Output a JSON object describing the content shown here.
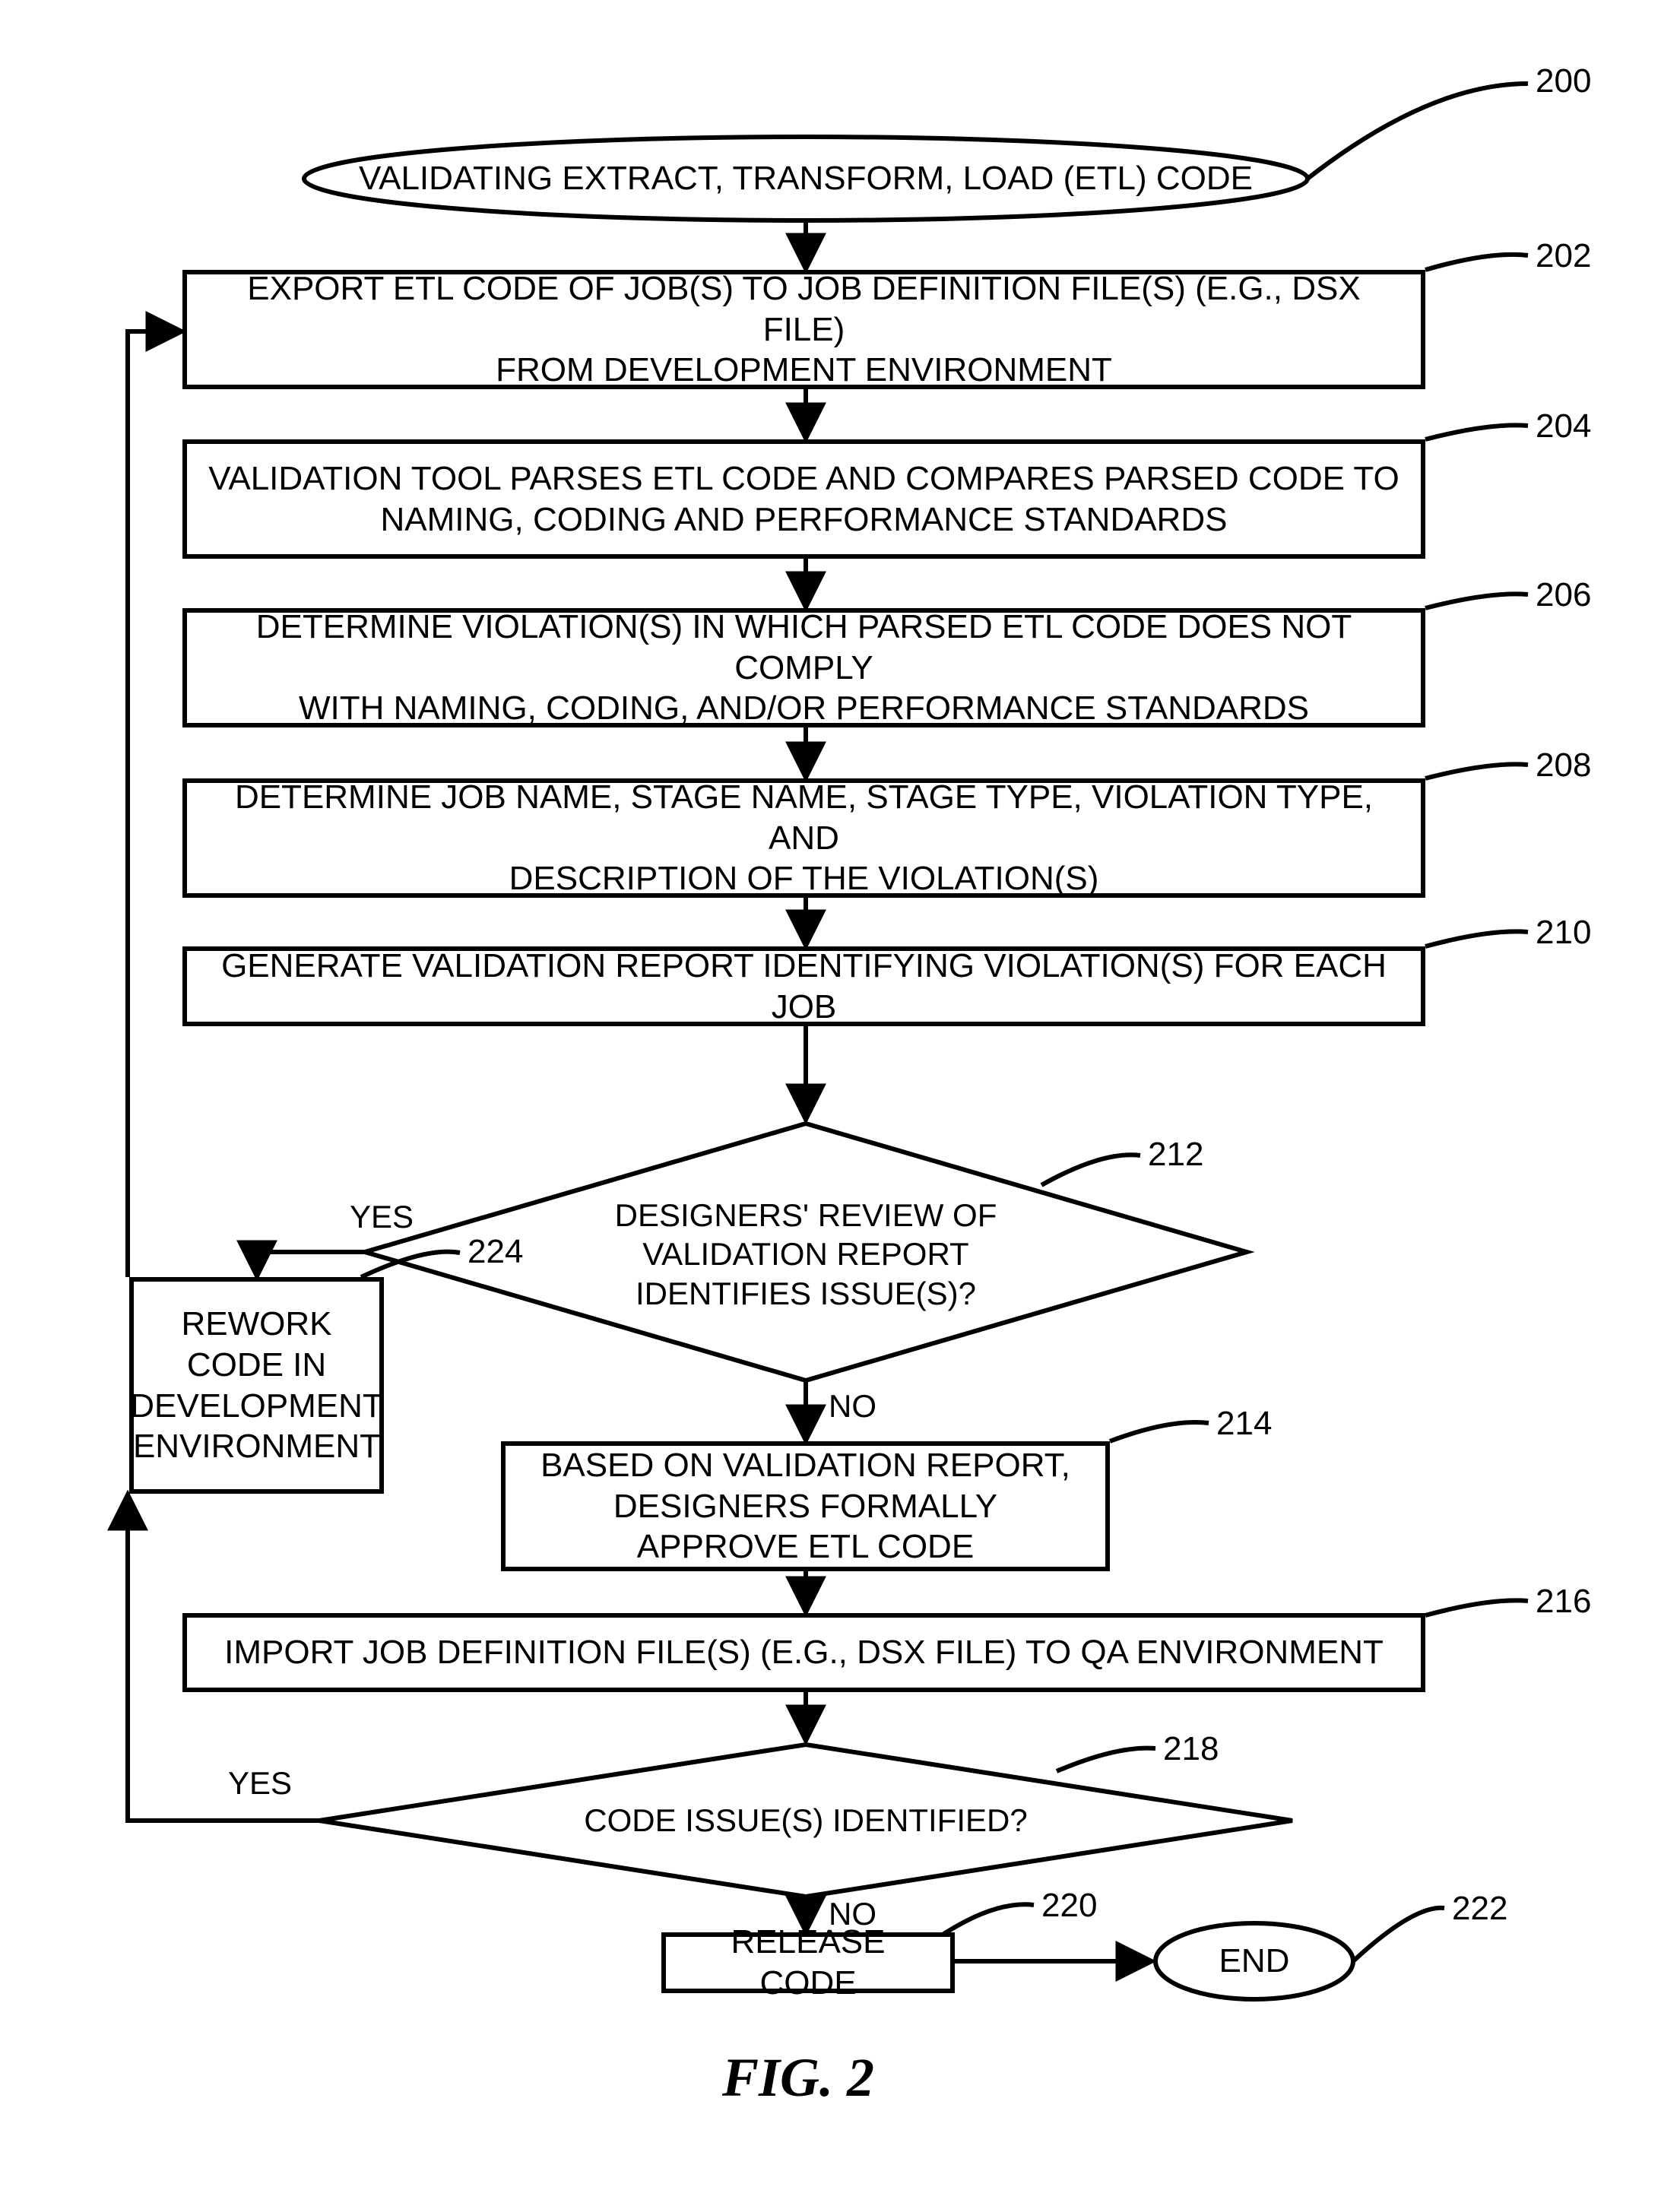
{
  "figure_caption": "FIG. 2",
  "terminal": {
    "start": {
      "text": "VALIDATING EXTRACT, TRANSFORM, LOAD (ETL) CODE",
      "callout": "200"
    },
    "end": {
      "text": "END",
      "callout": "222"
    }
  },
  "steps": {
    "s202": {
      "text": "EXPORT ETL CODE OF JOB(S) TO JOB DEFINITION FILE(S) (E.G., DSX FILE)\nFROM DEVELOPMENT ENVIRONMENT",
      "callout": "202"
    },
    "s204": {
      "text": "VALIDATION TOOL PARSES ETL CODE AND COMPARES PARSED CODE TO\nNAMING, CODING AND PERFORMANCE STANDARDS",
      "callout": "204"
    },
    "s206": {
      "text": "DETERMINE VIOLATION(S) IN WHICH PARSED ETL CODE DOES NOT COMPLY\nWITH NAMING, CODING, AND/OR PERFORMANCE STANDARDS",
      "callout": "206"
    },
    "s208": {
      "text": "DETERMINE JOB NAME, STAGE NAME, STAGE TYPE, VIOLATION TYPE, AND\nDESCRIPTION OF THE VIOLATION(S)",
      "callout": "208"
    },
    "s210": {
      "text": "GENERATE VALIDATION REPORT IDENTIFYING VIOLATION(S) FOR EACH JOB",
      "callout": "210"
    },
    "s214": {
      "text": "BASED ON VALIDATION REPORT,\nDESIGNERS FORMALLY\nAPPROVE ETL CODE",
      "callout": "214"
    },
    "s216": {
      "text": "IMPORT JOB DEFINITION FILE(S) (E.G., DSX FILE) TO QA ENVIRONMENT",
      "callout": "216"
    },
    "s220": {
      "text": "RELEASE CODE",
      "callout": "220"
    },
    "s224": {
      "text": "REWORK\nCODE IN\nDEVELOPMENT\nENVIRONMENT",
      "callout": "224"
    }
  },
  "decisions": {
    "d212": {
      "text": "DESIGNERS' REVIEW OF\nVALIDATION REPORT\nIDENTIFIES ISSUE(S)?",
      "callout": "212"
    },
    "d218": {
      "text": "CODE ISSUE(S) IDENTIFIED?",
      "callout": "218"
    }
  },
  "edges": {
    "yes212": "YES",
    "no212": "NO",
    "yes218": "YES",
    "no218": "NO"
  }
}
